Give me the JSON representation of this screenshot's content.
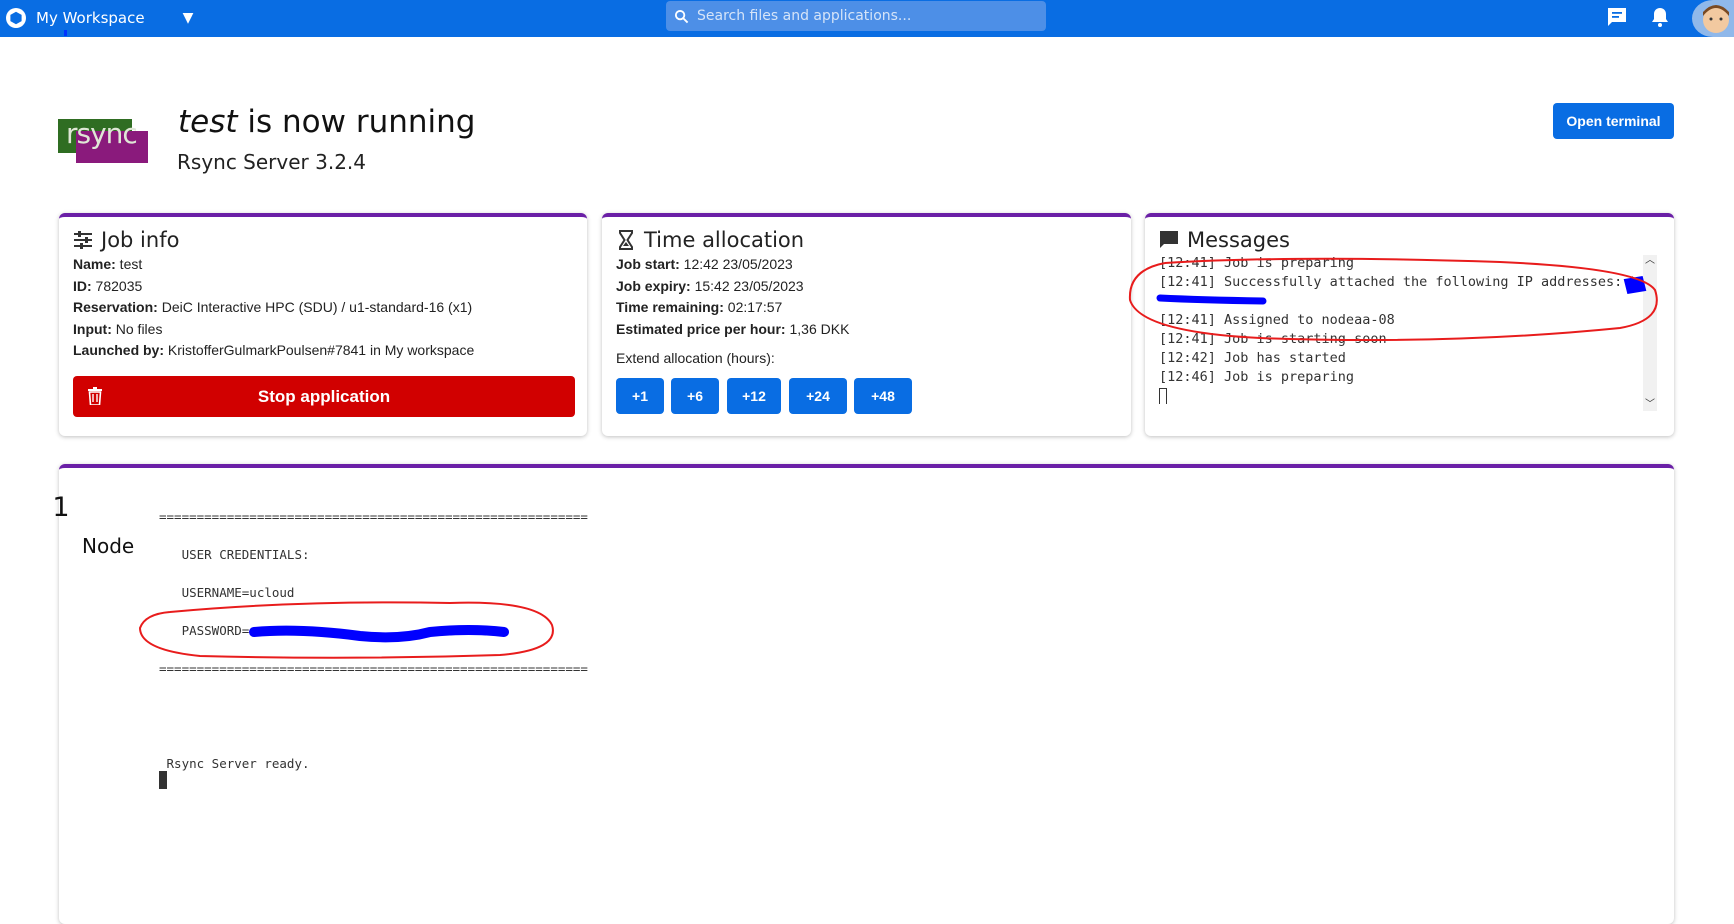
{
  "topbar": {
    "workspace_label": "My Workspace",
    "workspace_logo_icon": "hexagon-logo-icon",
    "dropdown_icon": "caret-down-icon",
    "search_placeholder": "Search files and applications...",
    "search_icon": "search-icon",
    "messages_icon": "chat-icon",
    "notifications_icon": "bell-icon",
    "avatar_icon": "avatar-icon",
    "color": "#096de3"
  },
  "header": {
    "app_name_italic": "test",
    "title_rest": " is now running",
    "subtitle": "Rsync Server 3.2.4",
    "logo_text": "rsync",
    "open_terminal_label": "Open terminal"
  },
  "job_info": {
    "title": "Job info",
    "icon": "sliders-icon",
    "rows": [
      {
        "label": "Name:",
        "value": " test"
      },
      {
        "label": "ID:",
        "value": " 782035"
      },
      {
        "label": "Reservation:",
        "value": " DeiC Interactive HPC (SDU) / u1-standard-16 (x1)"
      },
      {
        "label": "Input:",
        "value": " No files"
      },
      {
        "label": "Launched by:",
        "value": " KristofferGulmarkPoulsen#7841 in My workspace"
      }
    ],
    "stop_label": "Stop application",
    "stop_icon": "trash-icon",
    "stop_color": "#d10000"
  },
  "time_allocation": {
    "title": "Time allocation",
    "icon": "hourglass-icon",
    "rows": [
      {
        "label": "Job start:",
        "value": " 12:42 23/05/2023"
      },
      {
        "label": "Job expiry:",
        "value": " 15:42 23/05/2023"
      },
      {
        "label": "Time remaining:",
        "value": " 02:17:57"
      },
      {
        "label": "Estimated price per hour:",
        "value": " 1,36 DKK"
      }
    ],
    "extend_label": "Extend allocation (hours):",
    "extend_buttons": [
      "+1",
      "+6",
      "+12",
      "+24",
      "+48"
    ]
  },
  "messages": {
    "title": "Messages",
    "icon": "message-icon",
    "lines": [
      "[12:41] Job is preparing",
      "[12:41] Successfully attached the following IP addresses: 1",
      "",
      "[12:41] Assigned to nodeaa-08",
      "[12:41] Job is starting soon",
      "[12:42] Job has started",
      "[12:46] Job is preparing"
    ]
  },
  "node": {
    "count": "1",
    "label": "Node",
    "terminal_lines": [
      "=========================================================",
      "",
      "   USER CREDENTIALS:",
      "",
      "   USERNAME=ucloud",
      "",
      "   PASSWORD=",
      "",
      "=========================================================",
      "",
      "",
      "",
      "",
      " Rsync Server ready."
    ]
  },
  "annotations": {
    "circle_color": "#e81c1c",
    "redaction_color": "#0000ff"
  }
}
